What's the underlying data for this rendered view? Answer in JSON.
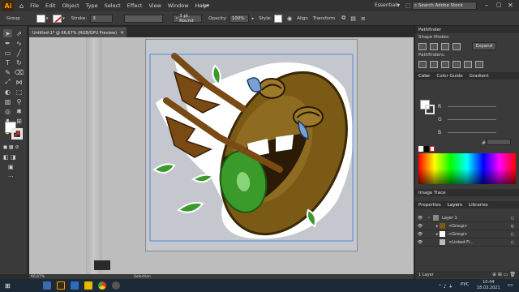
{
  "menubar": {
    "logo": "Ai",
    "items": [
      "File",
      "Edit",
      "Object",
      "Type",
      "Select",
      "Effect",
      "View",
      "Window",
      "Help"
    ],
    "workspace": "Essentials",
    "search_placeholder": "Search Adobe Stock"
  },
  "controlbar": {
    "selection_label": "Group",
    "stroke_label": "Stroke:",
    "brush_value": "3 pt. Round",
    "opacity_label": "Opacity:",
    "opacity_value": "100%",
    "style_label": "Style:",
    "align_label": "Align",
    "transform_label": "Transform"
  },
  "document": {
    "tab_title": "Untitled-1* @ 66,67% (RGB/GPU Preview)",
    "zoom": "66,67%",
    "status_tool": "Selection"
  },
  "panels": {
    "pathfinder": {
      "title": "Pathfinder",
      "shape_modes_label": "Shape Modes:",
      "pathfinders_label": "Pathfinders:",
      "expand_label": "Expand"
    },
    "color": {
      "tabs": [
        "Color",
        "Color Guide",
        "Gradient"
      ],
      "channels": [
        "R",
        "G",
        "B"
      ],
      "hex_prefix": "#"
    },
    "image_trace": {
      "title": "Image Trace"
    },
    "layers": {
      "tabs": [
        "Properties",
        "Layers",
        "Libraries"
      ],
      "rows": [
        "Layer 1",
        "<Group>",
        "<Group>",
        "<Linked Fi..."
      ],
      "footer": "1 Layer"
    }
  },
  "taskbar": {
    "time": "10:44",
    "date": "18.03.2021",
    "lang": "РУС"
  },
  "colors": {
    "accent": "#ff9a00",
    "kiwi_brown": "#7a5a14",
    "kiwi_green": "#3a9a2a",
    "tear_blue": "#7aa0d0",
    "selection_blue": "#3a7bd5"
  }
}
